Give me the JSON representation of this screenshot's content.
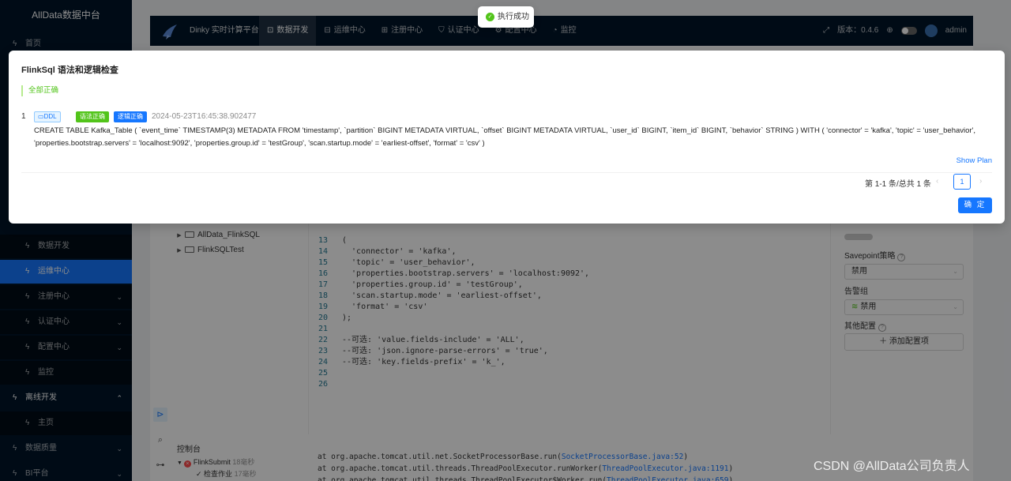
{
  "sidebar": {
    "title": "AllData数据中台",
    "top_item": "首页",
    "sub_items": [
      "数据开发",
      "运维中心",
      "注册中心",
      "认证中心",
      "配置中心",
      "监控"
    ],
    "group": "离线开发",
    "group_sub": "主页",
    "bottom_items": [
      "数据质量",
      "BI平台"
    ]
  },
  "topbar": {
    "brand": "Dinky 实时计算平台",
    "menu": [
      "数据开发",
      "运维中心",
      "注册中心",
      "认证中心",
      "配置中心",
      "监控"
    ],
    "version": "版本：0.4.6",
    "user": "admin"
  },
  "tree": [
    "AllData_FlinkSQL",
    "FlinkSQLTest"
  ],
  "editor": {
    "lines": [
      {
        "n": "13",
        "t": "("
      },
      {
        "n": "14",
        "t": "  'connector' = 'kafka',"
      },
      {
        "n": "15",
        "t": "  'topic' = 'user_behavior',"
      },
      {
        "n": "16",
        "t": "  'properties.bootstrap.servers' = 'localhost:9092',"
      },
      {
        "n": "17",
        "t": "  'properties.group.id' = 'testGroup',"
      },
      {
        "n": "18",
        "t": "  'scan.startup.mode' = 'earliest-offset',"
      },
      {
        "n": "19",
        "t": "  'format' = 'csv'"
      },
      {
        "n": "20",
        "t": ");"
      },
      {
        "n": "21",
        "t": ""
      },
      {
        "n": "22",
        "t": "--可选: 'value.fields-include' = 'ALL',"
      },
      {
        "n": "23",
        "t": "--可选: 'json.ignore-parse-errors' = 'true',"
      },
      {
        "n": "24",
        "t": "--可选: 'key.fields-prefix' = 'k_',"
      },
      {
        "n": "25",
        "t": ""
      },
      {
        "n": "26",
        "t": ""
      }
    ]
  },
  "panel": {
    "savepoint_label": "Savepoint策略",
    "savepoint_value": "禁用",
    "alert_label": "告警组",
    "alert_value": "禁用",
    "other_label": "其他配置",
    "add_config": "添加配置项"
  },
  "console": {
    "title": "控制台",
    "submit_label": "FlinkSubmit",
    "submit_time": "18毫秒",
    "check_label": "检查作业",
    "check_time": "17毫秒",
    "log_lines": [
      {
        "pre": "at org.apache.tomcat.util.net.SocketProcessorBase.run(",
        "link": "SocketProcessorBase.java",
        "num": ":52",
        "post": ")"
      },
      {
        "pre": "at org.apache.tomcat.util.threads.ThreadPoolExecutor.runWorker(",
        "link": "ThreadPoolExecutor.java",
        "num": ":1191",
        "post": ")"
      },
      {
        "pre": "at org.apache.tomcat.util.threads.ThreadPoolExecutor$Worker.run(",
        "link": "ThreadPoolExecutor.java",
        "num": ":659",
        "post": ")"
      }
    ]
  },
  "modal": {
    "title": "FlinkSql 语法和逻辑检查",
    "alert": "全部正确",
    "index": "1",
    "ddl_tag": "DDL",
    "tag_syntax": "语法正确",
    "tag_logic": "逻辑正确",
    "timestamp": "2024-05-23T16:45:38.902477",
    "sql_line1": "CREATE TABLE Kafka_Table ( `event_time` TIMESTAMP(3) METADATA FROM 'timestamp', `partition` BIGINT METADATA VIRTUAL, `offset` BIGINT METADATA VIRTUAL, `user_id` BIGINT, `item_id` BIGINT, `behavior` STRING ) WITH ( 'connector' = 'kafka', 'topic' = 'user_behavior',",
    "sql_line2": "'properties.bootstrap.servers' = 'localhost:9092', 'properties.group.id' = 'testGroup', 'scan.startup.mode' = 'earliest-offset', 'format' = 'csv' )",
    "show_plan": "Show Plan",
    "total": "第 1-1 条/总共 1 条",
    "page": "1",
    "ok": "确 定"
  },
  "toast": {
    "text": "执行成功"
  },
  "watermark": "CSDN @AllData公司负责人"
}
